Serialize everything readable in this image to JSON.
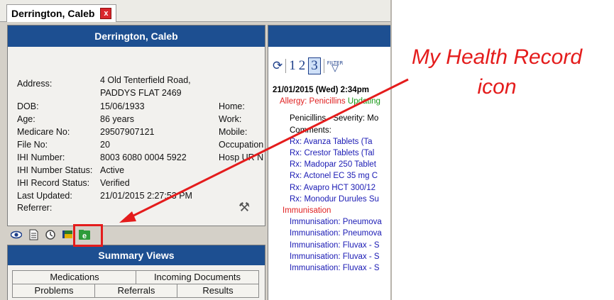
{
  "tab": {
    "title": "Derrington, Caleb",
    "close": "x"
  },
  "patient": {
    "header": "Derrington, Caleb",
    "address_label": "Address:",
    "address_line1": "4 Old Tenterfield Road,",
    "address_line2": "PADDYS FLAT  2469",
    "dob_label": "DOB:",
    "dob": "15/06/1933",
    "age_label": "Age:",
    "age": "86 years",
    "medicare_label": "Medicare No:",
    "medicare": "29507907121",
    "file_label": "File No:",
    "file": "20",
    "ihi_label": "IHI Number:",
    "ihi": "8003 6080 0004 5922",
    "ihi_status_label": "IHI Number Status:",
    "ihi_status": "Active",
    "ihi_record_label": "IHI Record Status:",
    "ihi_record": "Verified",
    "updated_label": "Last Updated:",
    "updated": "21/01/2015 2:27:53 PM",
    "referrer_label": "Referrer:",
    "home_label": "Home:",
    "work_label": "Work:",
    "mobile_label": "Mobile:",
    "occupation_label": "Occupation",
    "hosp_label": "Hosp UR N"
  },
  "summary": {
    "title": "Summary Views",
    "buttons": [
      "Medications",
      "Incoming Documents",
      "Problems",
      "Referrals",
      "Results"
    ]
  },
  "toolbar": {
    "p1": "1",
    "p2": "2",
    "p3": "3",
    "filter": "FILTER"
  },
  "notes": {
    "date": "21/01/2015 (Wed) 2:34pm",
    "allergy": "Allergy: Penicillins",
    "updating": "Updating",
    "pen": "Penicillins - Severity: Mo",
    "comments": "Comments:",
    "rx": [
      "Rx: Avanza Tablets (Ta",
      "Rx: Crestor Tablets (Tal",
      "Rx: Madopar 250 Tablet",
      "Rx: Actonel EC 35 mg C",
      "Rx: Avapro HCT 300/12",
      "Rx: Monodur Durules Su"
    ],
    "imm_header": "Immunisation",
    "imm": [
      "Immunisation: Pneumova",
      "Immunisation: Pneumova",
      "Immunisation: Fluvax - S",
      "Immunisation: Fluvax - S",
      "Immunisation: Fluvax - S"
    ]
  },
  "callout": {
    "line1": "My Health Record",
    "line2": "icon"
  },
  "colors": {
    "header": "#1d4f91",
    "highlight": "#e41c1c"
  }
}
